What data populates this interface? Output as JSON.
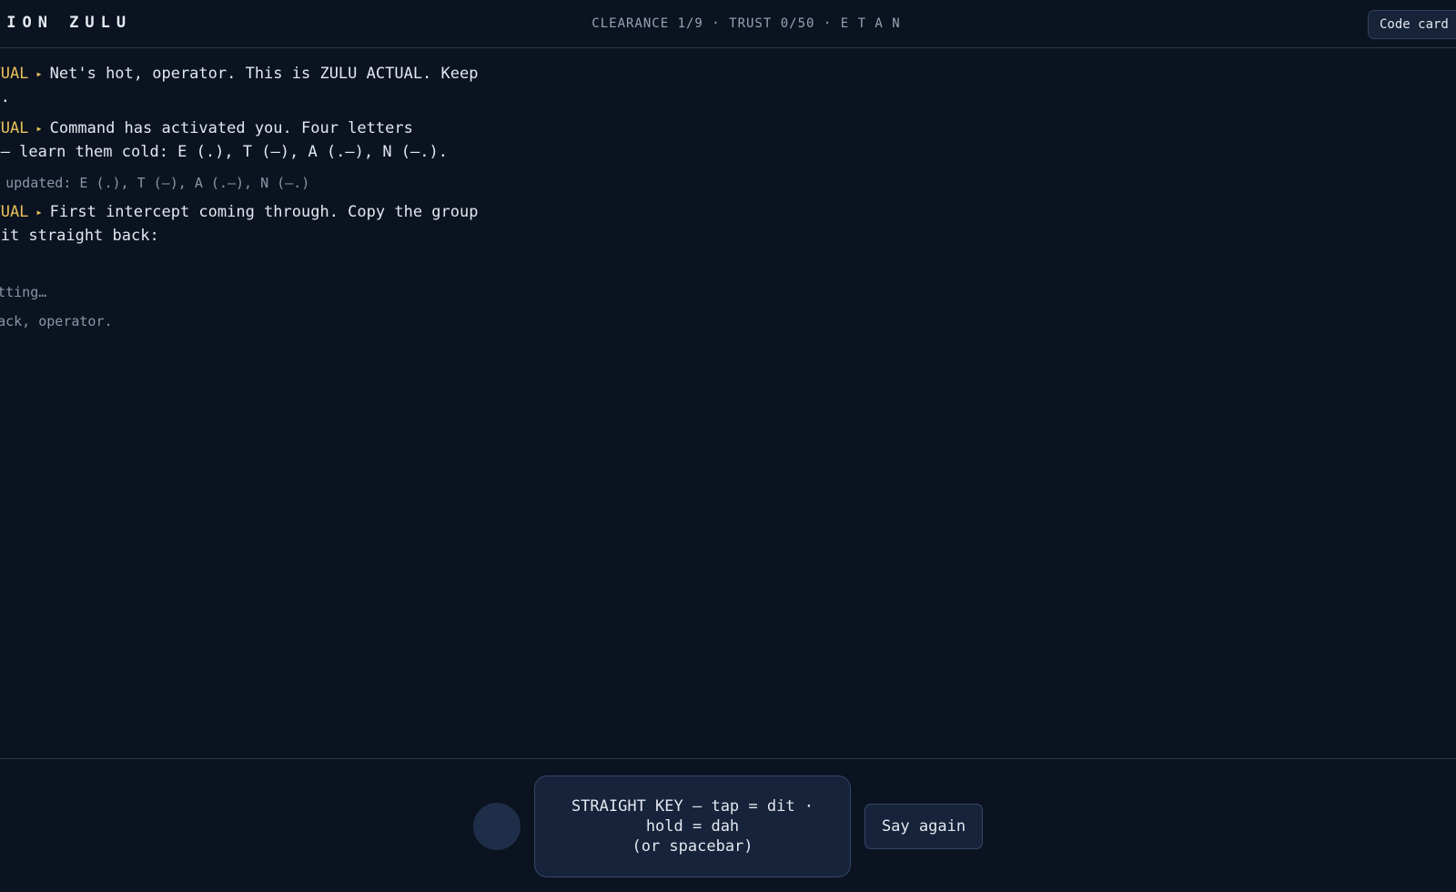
{
  "header": {
    "title": "TION ZULU",
    "status": "CLEARANCE 1/9 · TRUST 0/50 · E T A N",
    "code_card_label": "Code card"
  },
  "transcript": {
    "messages": [
      {
        "speaker": "ACTUAL",
        "line1": "Net's hot, operator. This is ZULU ACTUAL. Keep",
        "line2": "ght."
      },
      {
        "speaker": "ACTUAL",
        "line1": "Command has activated you. Four letters",
        "line2": "ht — learn them cold: E (.), T (–), A (.–), N (–.)."
      },
      {
        "system": "ard updated: E (.), T (–), A (.–), N (–.)"
      },
      {
        "speaker": "ACTUAL",
        "line1": "First intercept coming through. Copy the group",
        "line2": "ey it straight back:"
      }
    ],
    "dot_line": ".",
    "transmitting": "smitting…",
    "prompt": "t back, operator.",
    "separator": "▸"
  },
  "console": {
    "key_line1": "STRAIGHT KEY — tap = dit ·",
    "key_line2": "hold = dah",
    "key_line3": "(or spacebar)",
    "say_again_label": "Say again"
  },
  "colors": {
    "background": "#0b1320",
    "speaker": "#e8c25b",
    "text": "#e3e8ef",
    "muted": "#8a95a6",
    "button_bg": "#16233a"
  }
}
